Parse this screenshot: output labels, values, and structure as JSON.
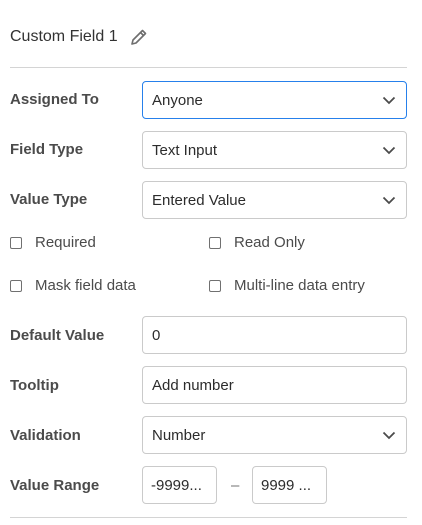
{
  "header": {
    "title": "Custom Field 1",
    "edit_icon": "pencil-icon"
  },
  "rows": {
    "assigned_to": {
      "label": "Assigned To",
      "value": "Anyone"
    },
    "field_type": {
      "label": "Field Type",
      "value": "Text Input"
    },
    "value_type": {
      "label": "Value Type",
      "value": "Entered Value"
    },
    "default_value": {
      "label": "Default Value",
      "value": "0"
    },
    "tooltip": {
      "label": "Tooltip",
      "value": "Add number"
    },
    "validation": {
      "label": "Validation",
      "value": "Number"
    },
    "value_range": {
      "label": "Value Range",
      "min": "-9999...",
      "separator": "–",
      "max": "9999 ..."
    }
  },
  "checkboxes": {
    "required": {
      "label": "Required",
      "checked": false
    },
    "read_only": {
      "label": "Read Only",
      "checked": false
    },
    "mask_field_data": {
      "label": "Mask field data",
      "checked": false
    },
    "multi_line": {
      "label": "Multi-line data entry",
      "checked": false
    }
  },
  "colors": {
    "focus_border": "#2680eb",
    "field_border": "#cacaca",
    "divider": "#d4d4d4"
  }
}
